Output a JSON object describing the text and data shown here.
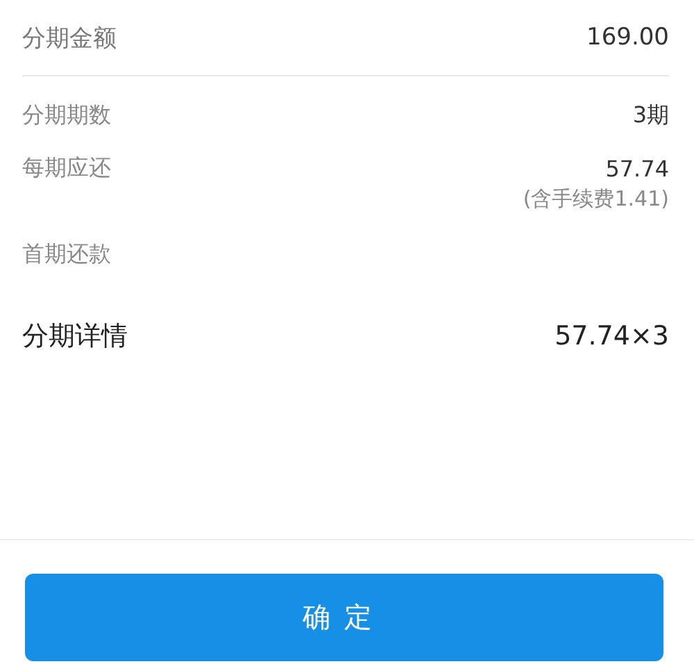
{
  "amount": {
    "label": "分期金额",
    "value": "169.00"
  },
  "details": [
    {
      "label": "分期期数",
      "value": "3期"
    },
    {
      "label": "每期应还",
      "value": "57.74",
      "note": "(含手续费1.41)"
    },
    {
      "label": "首期还款"
    }
  ],
  "summary": {
    "label": "分期详情",
    "value": "57.74×3"
  },
  "confirm_button": "确定"
}
